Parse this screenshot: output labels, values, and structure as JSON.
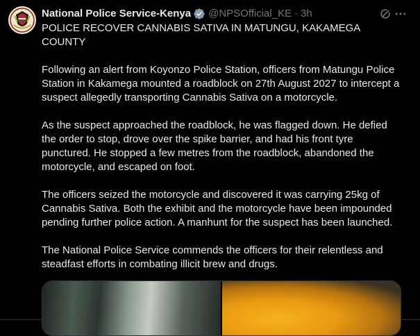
{
  "author": {
    "display_name": "National Police Service-Kenya",
    "handle": "@NPSOfficial_KE",
    "separator": "·",
    "timestamp": "3h",
    "avatar_icon": "kenya-police-crest",
    "verified_color": "#829aab"
  },
  "post": {
    "paragraphs": [
      "POLICE RECOVER CANNABIS SATIVA IN MATUNGU, KAKAMEGA COUNTY",
      "Following an alert from Koyonzo Police Station, officers from Matungu Police Station in Kakamega mounted a roadblock on 27th August 2027 to intercept a suspect allegedly transporting Cannabis Sativa on a motorcycle.",
      "As the suspect approached the roadblock, he was flagged down. He defied the order to stop, drove over the spike barrier, and had his front tyre punctured. He stopped a few metres from the roadblock, abandoned the motorcycle, and escaped on foot.",
      "The officers seized the motorcycle and discovered it was carrying 25kg of Cannabis Sativa. Both the exhibit and the motorcycle have been impounded pending further police action. A manhunt for the suspect has been launched.",
      "The National Police Service commends the officers for their relentless and steadfast efforts in combating illicit brew and drugs."
    ]
  },
  "icons": {
    "grok": "grok-icon",
    "more": "more-icon"
  },
  "colors": {
    "background": "#000000",
    "text": "#e7e9ea",
    "secondary": "#71767b",
    "border": "#2f3336"
  }
}
